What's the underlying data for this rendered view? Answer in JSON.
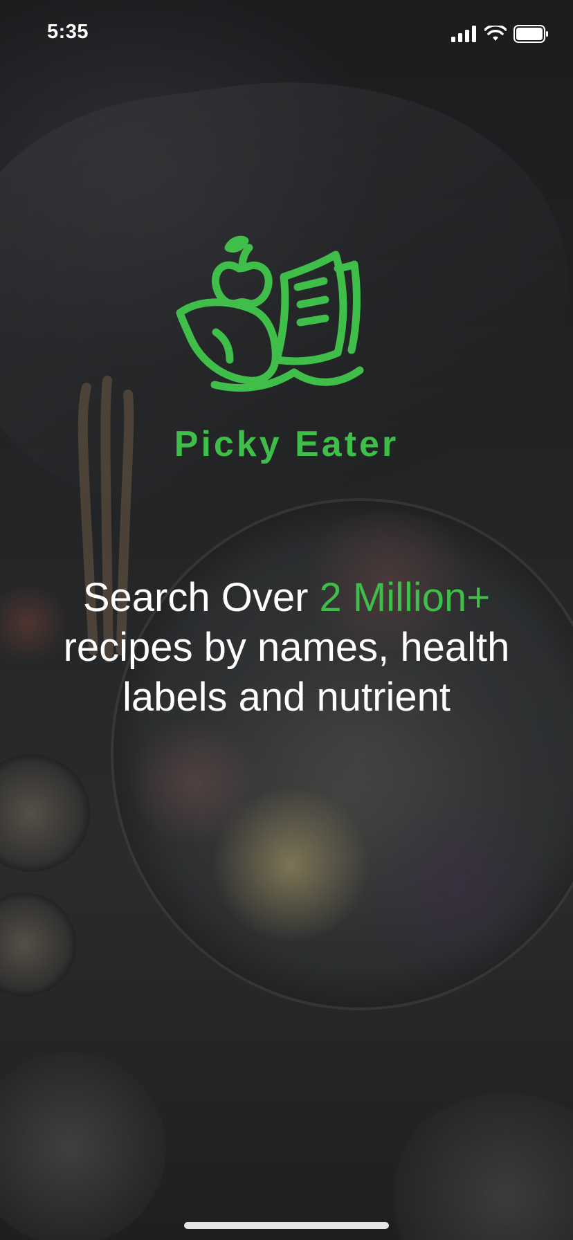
{
  "status_bar": {
    "time": "5:35",
    "signal_icon": "cellular-signal-icon",
    "wifi_icon": "wifi-icon",
    "battery_icon": "battery-icon"
  },
  "brand": {
    "name": "Picky Eater",
    "logo_icon": "apple-book-leaf-logo",
    "color": "#3fbf4a"
  },
  "tagline": {
    "prefix": "Search Over ",
    "highlight": "2 Million+",
    "line2": "recipes by names, health",
    "line3": "labels and nutrient"
  },
  "colors": {
    "accent": "#3fbf4a",
    "text": "#ffffff",
    "background": "#1a1c1d"
  }
}
